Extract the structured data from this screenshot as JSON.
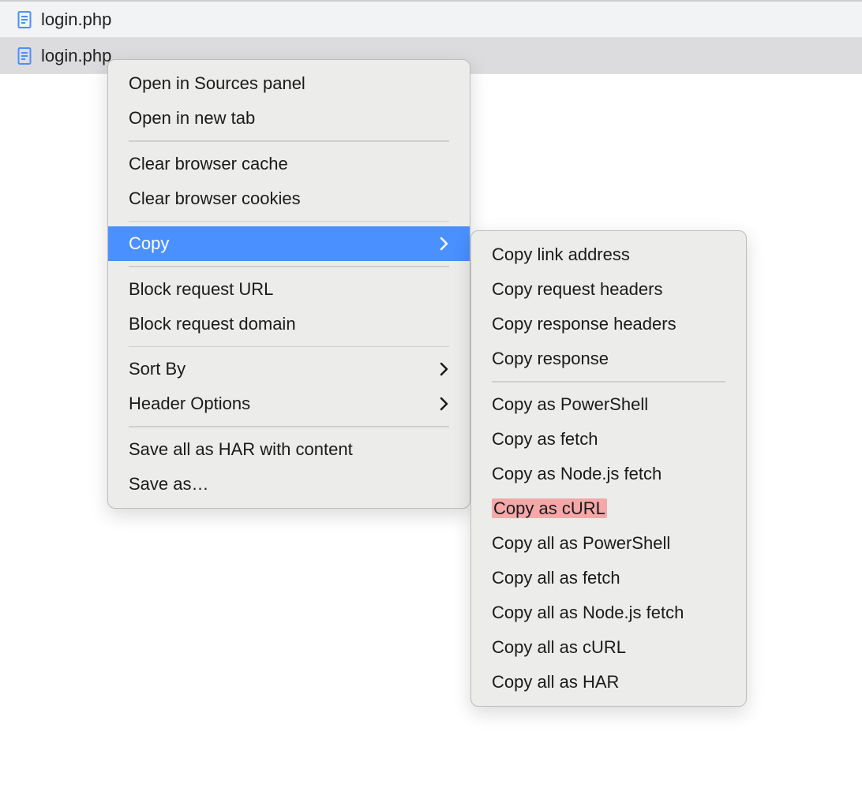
{
  "network_rows": [
    {
      "filename": "login.php"
    },
    {
      "filename": "login.php"
    }
  ],
  "context_menu": {
    "group1": [
      {
        "label": "Open in Sources panel"
      },
      {
        "label": "Open in new tab"
      }
    ],
    "group2": [
      {
        "label": "Clear browser cache"
      },
      {
        "label": "Clear browser cookies"
      }
    ],
    "group3": [
      {
        "label": "Copy",
        "submenu": true,
        "highlighted": true
      }
    ],
    "group4": [
      {
        "label": "Block request URL"
      },
      {
        "label": "Block request domain"
      }
    ],
    "group5": [
      {
        "label": "Sort By",
        "submenu": true
      },
      {
        "label": "Header Options",
        "submenu": true
      }
    ],
    "group6": [
      {
        "label": "Save all as HAR with content"
      },
      {
        "label": "Save as…"
      }
    ]
  },
  "copy_submenu": {
    "group1": [
      {
        "label": "Copy link address"
      },
      {
        "label": "Copy request headers"
      },
      {
        "label": "Copy response headers"
      },
      {
        "label": "Copy response"
      }
    ],
    "group2": [
      {
        "label": "Copy as PowerShell"
      },
      {
        "label": "Copy as fetch"
      },
      {
        "label": "Copy as Node.js fetch"
      },
      {
        "label": "Copy as cURL",
        "highlight": true
      },
      {
        "label": "Copy all as PowerShell"
      },
      {
        "label": "Copy all as fetch"
      },
      {
        "label": "Copy all as Node.js fetch"
      },
      {
        "label": "Copy all as cURL"
      },
      {
        "label": "Copy all as HAR"
      }
    ]
  }
}
